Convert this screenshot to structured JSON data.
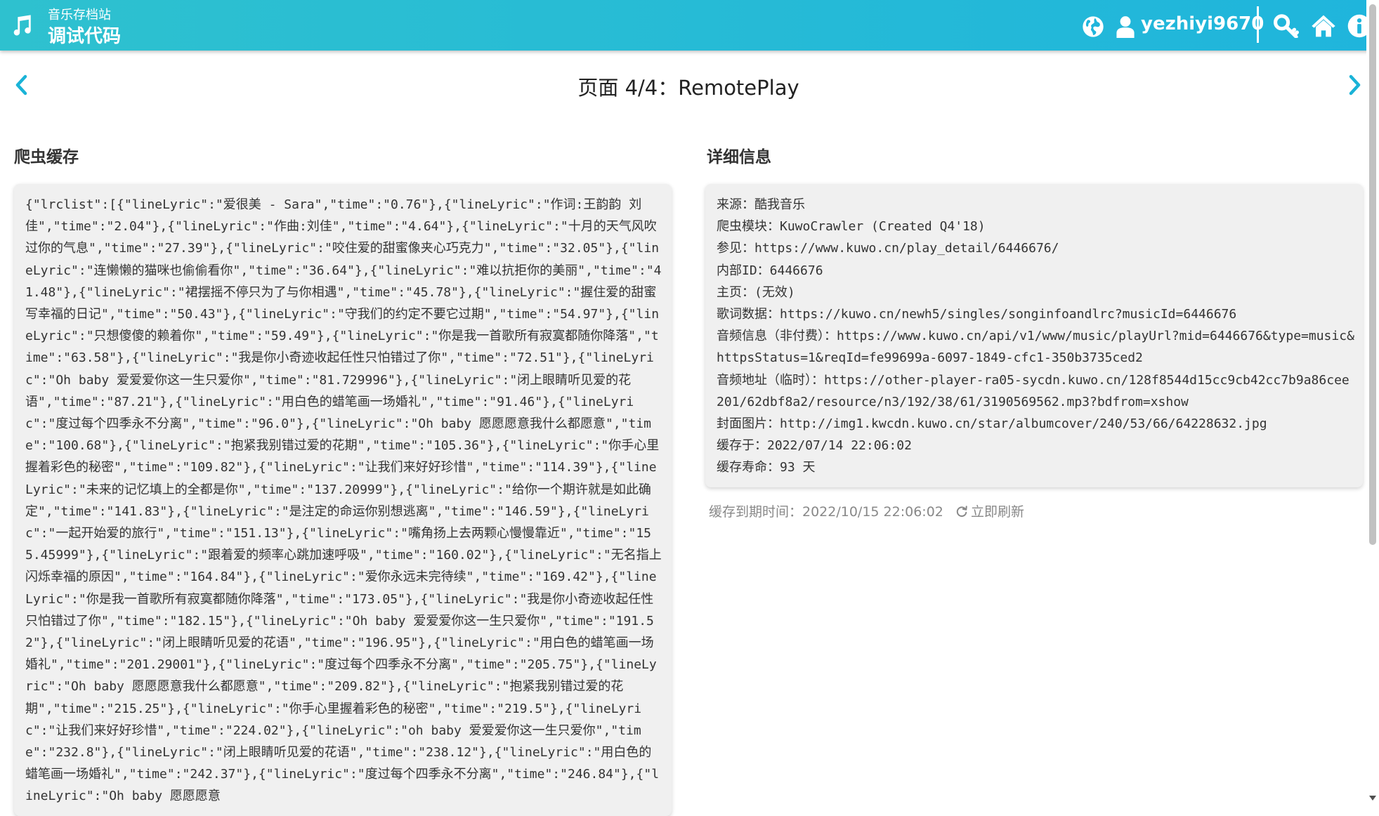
{
  "header": {
    "site_name": "音乐存档站",
    "page_name": "调试代码",
    "username": "yezhiyi9670",
    "icons": [
      "music-icon",
      "globe-icon",
      "user-icon",
      "key-icon",
      "home-icon",
      "info-icon"
    ],
    "background": "#1fb5dc"
  },
  "pager": {
    "title": "页面 4/4：RemotePlay",
    "prev_icon": "chevron-left-icon",
    "next_icon": "chevron-right-icon",
    "accent": "#1ab3d7"
  },
  "cache": {
    "heading": "爬虫缓存",
    "content": "{\"lrclist\":[{\"lineLyric\":\"爱很美 - Sara\",\"time\":\"0.76\"},{\"lineLyric\":\"作词:王韵韵 刘佳\",\"time\":\"2.04\"},{\"lineLyric\":\"作曲:刘佳\",\"time\":\"4.64\"},{\"lineLyric\":\"十月的天气风吹过你的气息\",\"time\":\"27.39\"},{\"lineLyric\":\"咬住爱的甜蜜像夹心巧克力\",\"time\":\"32.05\"},{\"lineLyric\":\"连懒懒的猫咪也偷偷看你\",\"time\":\"36.64\"},{\"lineLyric\":\"难以抗拒你的美丽\",\"time\":\"41.48\"},{\"lineLyric\":\"裙摆摇不停只为了与你相遇\",\"time\":\"45.78\"},{\"lineLyric\":\"握住爱的甜蜜写幸福的日记\",\"time\":\"50.43\"},{\"lineLyric\":\"守我们的约定不要它过期\",\"time\":\"54.97\"},{\"lineLyric\":\"只想傻傻的赖着你\",\"time\":\"59.49\"},{\"lineLyric\":\"你是我一首歌所有寂寞都随你降落\",\"time\":\"63.58\"},{\"lineLyric\":\"我是你小奇迹收起任性只怕错过了你\",\"time\":\"72.51\"},{\"lineLyric\":\"Oh baby 爱爱爱你这一生只爱你\",\"time\":\"81.729996\"},{\"lineLyric\":\"闭上眼睛听见爱的花语\",\"time\":\"87.21\"},{\"lineLyric\":\"用白色的蜡笔画一场婚礼\",\"time\":\"91.46\"},{\"lineLyric\":\"度过每个四季永不分离\",\"time\":\"96.0\"},{\"lineLyric\":\"Oh baby 愿愿愿意我什么都愿意\",\"time\":\"100.68\"},{\"lineLyric\":\"抱紧我别错过爱的花期\",\"time\":\"105.36\"},{\"lineLyric\":\"你手心里握着彩色的秘密\",\"time\":\"109.82\"},{\"lineLyric\":\"让我们来好好珍惜\",\"time\":\"114.39\"},{\"lineLyric\":\"未来的记忆填上的全都是你\",\"time\":\"137.20999\"},{\"lineLyric\":\"给你一个期许就是如此确定\",\"time\":\"141.83\"},{\"lineLyric\":\"是注定的命运你别想逃离\",\"time\":\"146.59\"},{\"lineLyric\":\"一起开始爱的旅行\",\"time\":\"151.13\"},{\"lineLyric\":\"嘴角扬上去两颗心慢慢靠近\",\"time\":\"155.45999\"},{\"lineLyric\":\"跟着爱的频率心跳加速呼吸\",\"time\":\"160.02\"},{\"lineLyric\":\"无名指上闪烁幸福的原因\",\"time\":\"164.84\"},{\"lineLyric\":\"爱你永远未完待续\",\"time\":\"169.42\"},{\"lineLyric\":\"你是我一首歌所有寂寞都随你降落\",\"time\":\"173.05\"},{\"lineLyric\":\"我是你小奇迹收起任性只怕错过了你\",\"time\":\"182.15\"},{\"lineLyric\":\"Oh baby 爱爱爱你这一生只爱你\",\"time\":\"191.52\"},{\"lineLyric\":\"闭上眼睛听见爱的花语\",\"time\":\"196.95\"},{\"lineLyric\":\"用白色的蜡笔画一场婚礼\",\"time\":\"201.29001\"},{\"lineLyric\":\"度过每个四季永不分离\",\"time\":\"205.75\"},{\"lineLyric\":\"Oh baby 愿愿愿意我什么都愿意\",\"time\":\"209.82\"},{\"lineLyric\":\"抱紧我别错过爱的花期\",\"time\":\"215.25\"},{\"lineLyric\":\"你手心里握着彩色的秘密\",\"time\":\"219.5\"},{\"lineLyric\":\"让我们来好好珍惜\",\"time\":\"224.02\"},{\"lineLyric\":\"oh baby 爱爱爱你这一生只爱你\",\"time\":\"232.8\"},{\"lineLyric\":\"闭上眼睛听见爱的花语\",\"time\":\"238.12\"},{\"lineLyric\":\"用白色的蜡笔画一场婚礼\",\"time\":\"242.37\"},{\"lineLyric\":\"度过每个四季永不分离\",\"time\":\"246.84\"},{\"lineLyric\":\"Oh baby 愿愿愿意"
  },
  "details": {
    "heading": "详细信息",
    "items": [
      "来源：酷我音乐",
      "爬虫模块：KuwoCrawler (Created Q4'18)",
      "参见：https://www.kuwo.cn/play_detail/6446676/",
      "内部ID：6446676",
      "主页：(无效)",
      "歌词数据：https://kuwo.cn/newh5/singles/songinfoandlrc?musicId=6446676",
      "音频信息（非付费）：https://www.kuwo.cn/api/v1/www/music/playUrl?mid=6446676&type=music&httpsStatus=1&reqId=fe99699a-6097-1849-cfc1-350b3735ced2",
      "音频地址（临时）：https://other-player-ra05-sycdn.kuwo.cn/128f8544d15cc9cb42cc7b9a86cee201/62dbf8a2/resource/n3/192/38/61/3190569562.mp3?bdfrom=xshow",
      "封面图片：http://img1.kwcdn.kuwo.cn/star/albumcover/240/53/66/64228632.jpg",
      "缓存于：2022/07/14 22:06:02",
      "缓存寿命：93 天"
    ],
    "expiry_text": "缓存到期时间：2022/10/15 22:06:02",
    "refresh_label": "立即刷新",
    "refresh_icon": "refresh-icon"
  }
}
